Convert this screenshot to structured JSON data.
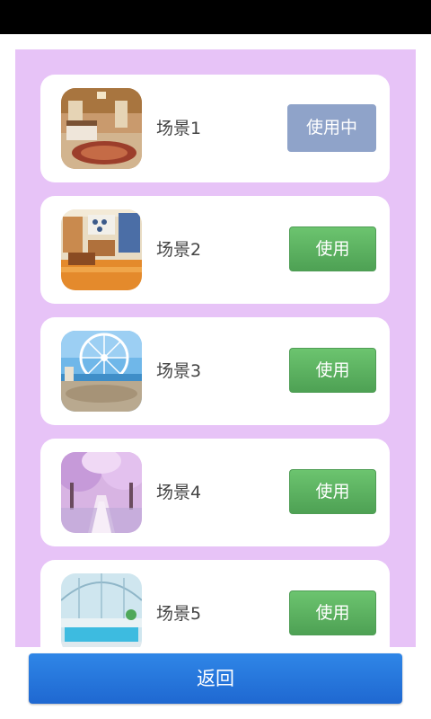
{
  "scenes": [
    {
      "label": "场景1",
      "button": "使用中",
      "state": "active",
      "thumb": "bedroom-thumbnail"
    },
    {
      "label": "场景2",
      "button": "使用",
      "state": "available",
      "thumb": "kitchen-thumbnail"
    },
    {
      "label": "场景3",
      "button": "使用",
      "state": "available",
      "thumb": "ferris-wheel-thumbnail"
    },
    {
      "label": "场景4",
      "button": "使用",
      "state": "available",
      "thumb": "cherry-blossom-thumbnail"
    },
    {
      "label": "场景5",
      "button": "使用",
      "state": "available",
      "thumb": "pool-thumbnail"
    }
  ],
  "footer": {
    "back_label": "返回"
  },
  "colors": {
    "panel_bg": "#e7c3f7",
    "use_button": "#5bb05f",
    "active_button": "#8fa3c9",
    "back_button": "#2a7ae0"
  }
}
